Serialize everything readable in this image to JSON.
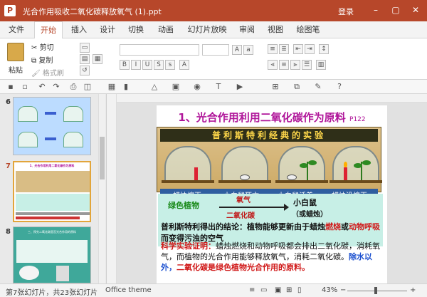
{
  "window": {
    "title": "光合作用吸收二氧化碳释放氧气 (1).ppt",
    "login": "登录",
    "minimize": "–",
    "maximize": "▢",
    "close": "✕",
    "app_icon": "P",
    "accent": "#b7472a"
  },
  "tabs": [
    "文件",
    "开始",
    "插入",
    "设计",
    "切换",
    "动画",
    "幻灯片放映",
    "审阅",
    "视图",
    "绘图笔"
  ],
  "active_tab": "开始",
  "ribbon": {
    "paste": "粘贴",
    "cut": "剪切",
    "copy": "复制",
    "format_painter": "格式刷"
  },
  "thumbnails": [
    {
      "number": "6"
    },
    {
      "number": "7",
      "title": "1、光合作用利用二氧化碳作为原料"
    },
    {
      "number": "8",
      "title": "三、探究二氧化碳是否光合作用的原料"
    }
  ],
  "slide": {
    "title": "1、光合作用利用二氧化碳作为原料",
    "title_suffix": "P122",
    "banner": "普利斯特利经典的实验",
    "captions": [
      "蜡烛熄灭",
      "小白鼠死亡",
      "小白鼠活着",
      "蜡烛没熄灭"
    ],
    "green_plant": "绿色植物",
    "oxygen": "氧气",
    "co2": "二氧化碳",
    "mouse": "小白鼠",
    "candle": "（或蜡烛）",
    "conclusion_a": "普利斯特利得出的结论：植物能够更新由于蜡烛",
    "conclusion_burn": "燃烧",
    "conclusion_b": "或",
    "conclusion_animal": "动物呼吸",
    "conclusion_c": "而变得污浊的空气",
    "proof_label": "科学实验证明：",
    "proof_a": "蜡烛燃烧和动物呼吸都会排出二氧化碳，消耗氧气，而植物的光合作用能够释放氧气，消耗二氧化碳。",
    "proof_b": "除水以外，",
    "proof_c": "二氧化碳是绿色植物光合作用的原料。"
  },
  "status": {
    "slide_info": "第7张幻灯片，共23张幻灯片",
    "theme": "Office theme",
    "zoom": "43%",
    "minus": "−",
    "plus": "+"
  }
}
